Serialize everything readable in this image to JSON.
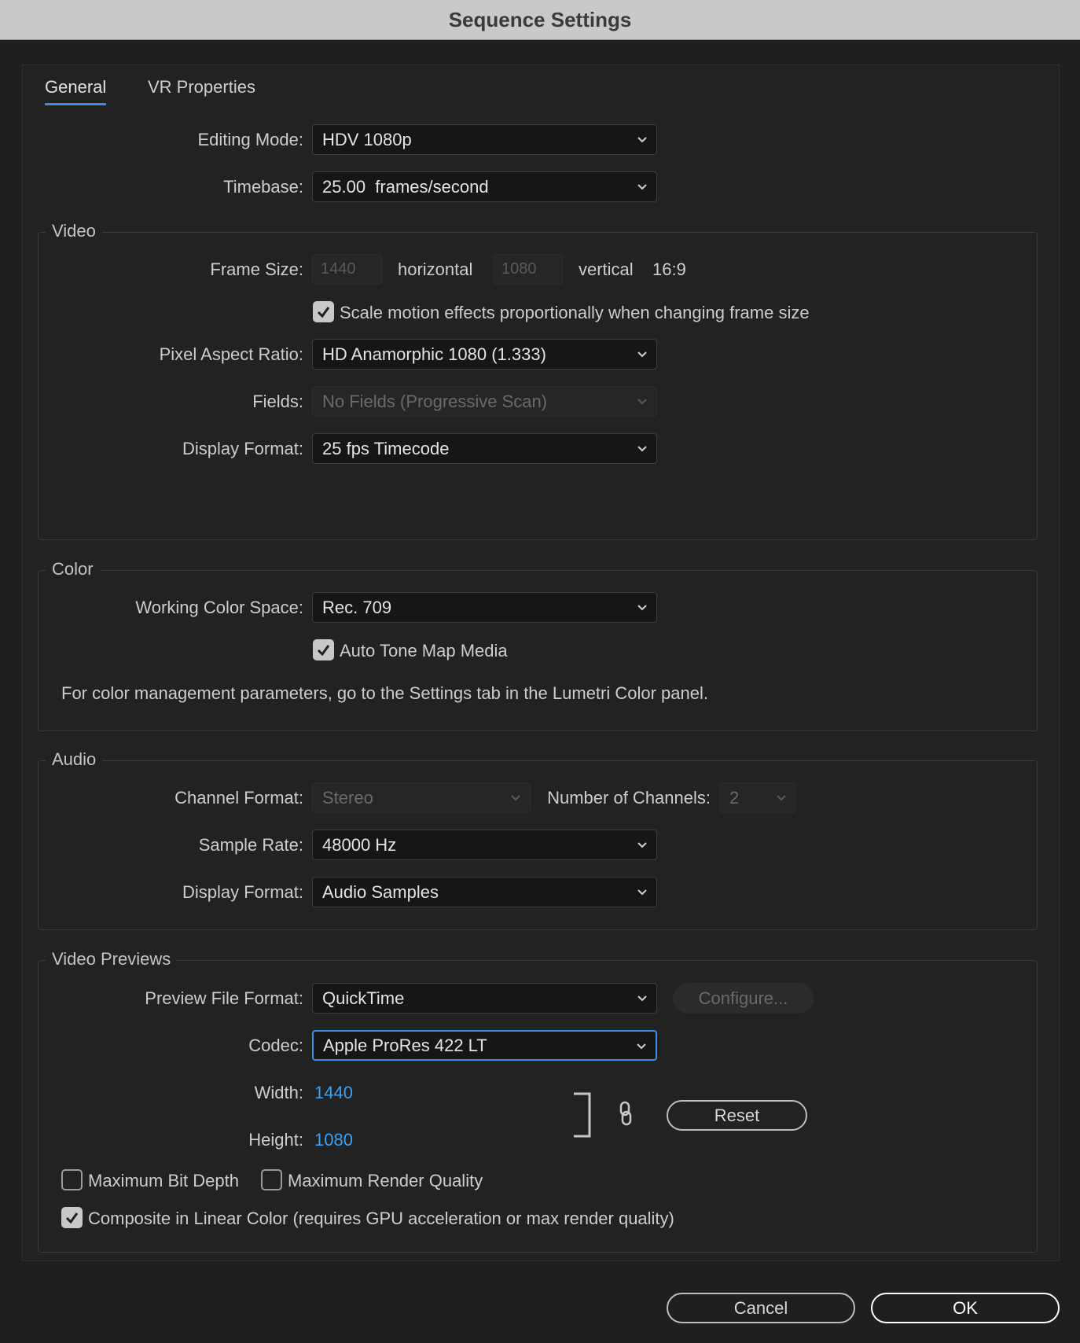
{
  "window": {
    "title": "Sequence Settings"
  },
  "tabs": [
    {
      "label": "General",
      "active": true
    },
    {
      "label": "VR Properties",
      "active": false
    }
  ],
  "general": {
    "editing_mode": {
      "label": "Editing Mode:",
      "value": "HDV 1080p"
    },
    "timebase": {
      "label": "Timebase:",
      "value": "25.00  frames/second"
    }
  },
  "video": {
    "title": "Video",
    "frame_size": {
      "label": "Frame Size:",
      "horizontal_value": "1440",
      "horizontal_label": "horizontal",
      "vertical_value": "1080",
      "vertical_label": "vertical",
      "aspect": "16:9"
    },
    "scale_motion": {
      "label": "Scale motion effects proportionally when changing frame size",
      "checked": true
    },
    "pixel_aspect": {
      "label": "Pixel Aspect Ratio:",
      "value": "HD Anamorphic 1080 (1.333)"
    },
    "fields": {
      "label": "Fields:",
      "value": "No Fields (Progressive Scan)"
    },
    "display_format": {
      "label": "Display Format:",
      "value": "25 fps Timecode"
    }
  },
  "color": {
    "title": "Color",
    "working_space": {
      "label": "Working Color Space:",
      "value": "Rec. 709"
    },
    "auto_tone": {
      "label": "Auto Tone Map Media",
      "checked": true
    },
    "note": "For color management parameters, go to the Settings tab in the Lumetri Color panel."
  },
  "audio": {
    "title": "Audio",
    "channel_format": {
      "label": "Channel Format:",
      "value": "Stereo"
    },
    "num_channels": {
      "label": "Number of Channels:",
      "value": "2"
    },
    "sample_rate": {
      "label": "Sample Rate:",
      "value": "48000 Hz"
    },
    "display_format": {
      "label": "Display Format:",
      "value": "Audio Samples"
    }
  },
  "previews": {
    "title": "Video Previews",
    "file_format": {
      "label": "Preview File Format:",
      "value": "QuickTime"
    },
    "configure_label": "Configure...",
    "codec": {
      "label": "Codec:",
      "value": "Apple ProRes 422 LT"
    },
    "width": {
      "label": "Width:",
      "value": "1440"
    },
    "height": {
      "label": "Height:",
      "value": "1080"
    },
    "reset_label": "Reset",
    "max_bit_depth": {
      "label": "Maximum Bit Depth",
      "checked": false
    },
    "max_render_quality": {
      "label": "Maximum Render Quality",
      "checked": false
    },
    "composite_linear": {
      "label": "Composite in Linear Color (requires GPU acceleration or max render quality)",
      "checked": true
    }
  },
  "footer": {
    "cancel_label": "Cancel",
    "ok_label": "OK"
  },
  "colors": {
    "accent": "#3a8ee6",
    "link": "#3aa0f0",
    "background": "#222222",
    "titlebar": "#c9c9c9"
  }
}
